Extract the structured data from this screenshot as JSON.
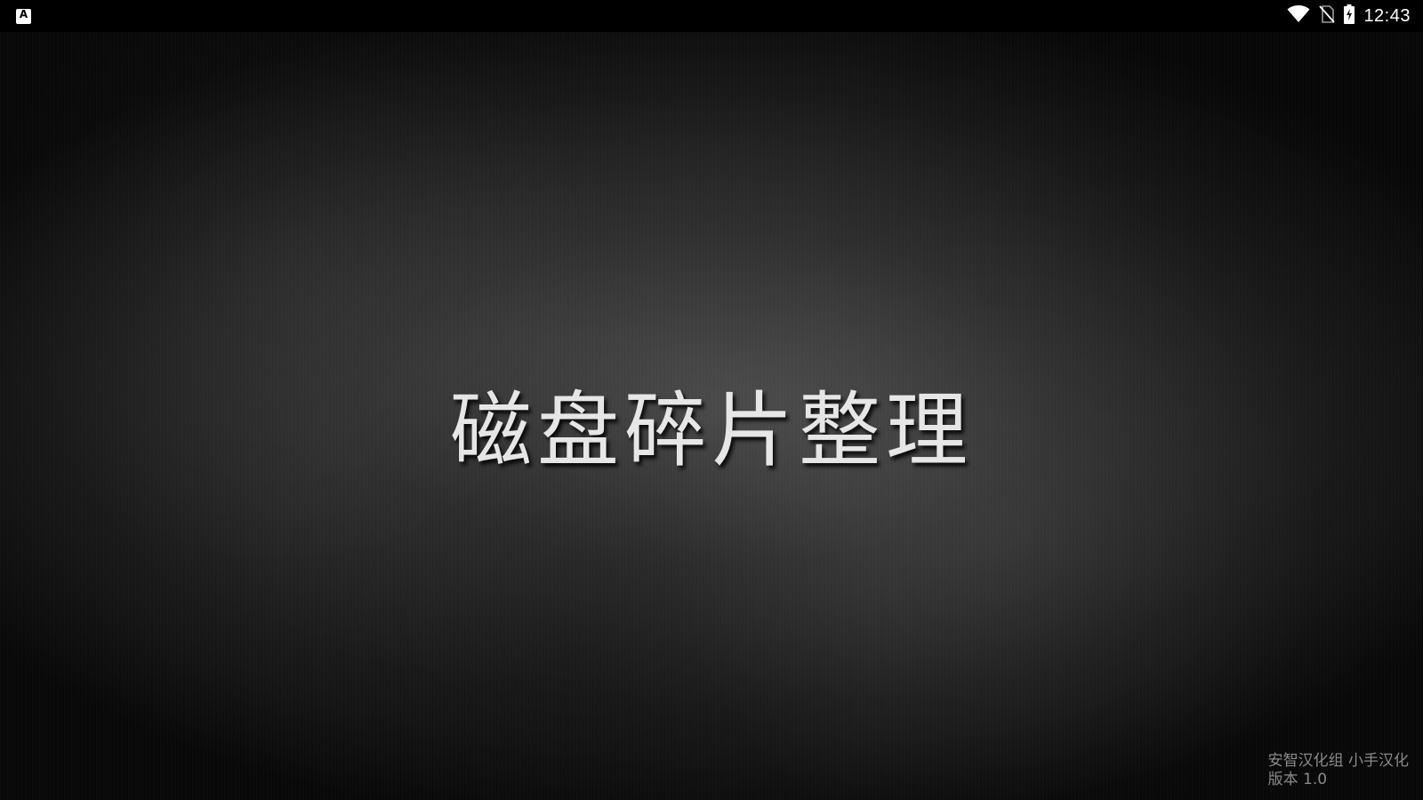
{
  "status_bar": {
    "notification_icon": "app-notification-icon",
    "icons": [
      "wifi-icon",
      "no-sim-icon",
      "battery-charging-icon"
    ],
    "time": "12:43"
  },
  "splash": {
    "title": "磁盘碎片整理",
    "credit_line": "安智汉化组 小手汉化",
    "version_line": "版本 1.0"
  }
}
